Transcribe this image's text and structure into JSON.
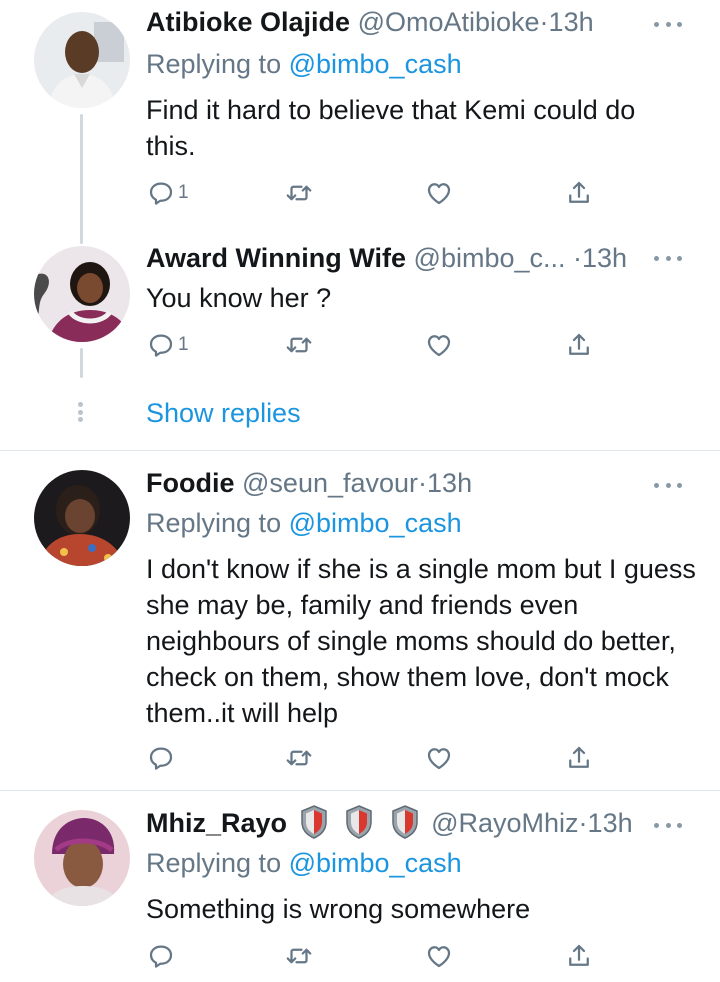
{
  "tweets": [
    {
      "name": "Atibioke Olajide",
      "handle": "@OmoAtibioke",
      "dot": "·",
      "time": "13h",
      "replying_prefix": "Replying to",
      "replying_to": "@bimbo_cash",
      "text": "Find it hard to believe that Kemi could do this.",
      "reply_count": "1"
    },
    {
      "name": "Award Winning Wife",
      "handle": "@bimbo_c...",
      "dot": "·",
      "time": "13h",
      "text": "You know her ?",
      "reply_count": "1"
    },
    {
      "name": "Foodie",
      "handle": "@seun_favour",
      "dot": "·",
      "time": "13h",
      "replying_prefix": "Replying to",
      "replying_to": "@bimbo_cash",
      "text": "I don't know if she is a single mom but I guess she may be, family and friends even neighbours of single moms should do better, check on them, show them love, don't mock them..it will help",
      "reply_count": ""
    },
    {
      "name": "Mhiz_Rayo",
      "handle": "@RayoMhiz",
      "dot": "·",
      "time": "13h",
      "replying_prefix": "Replying to",
      "replying_to": "@bimbo_cash",
      "text": "Something is wrong somewhere",
      "reply_count": "",
      "badge_icons": [
        "shield-icon",
        "shield-icon",
        "shield-icon"
      ]
    }
  ],
  "thread": {
    "show_replies_label": "Show replies"
  },
  "icons": {
    "reply": "speech-bubble-icon",
    "retweet": "retweet-icon",
    "like": "heart-icon",
    "share": "share-icon",
    "more": "more-dots-icon"
  },
  "colors": {
    "text": "#14171a",
    "secondary": "#657786",
    "link": "#1b95e0",
    "divider": "#e1e8ed",
    "thread_line": "#cfd9de"
  }
}
